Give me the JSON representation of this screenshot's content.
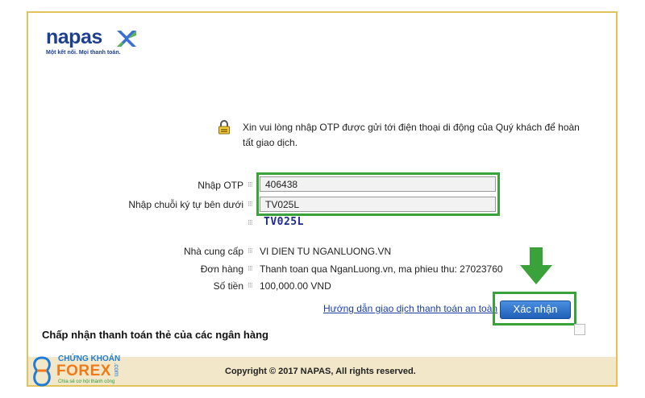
{
  "brand": {
    "name": "napas",
    "tagline": "Một kết nối. Mọi thanh toán.",
    "accent": "#1d3f8f"
  },
  "notice": "Xin vui lòng nhập OTP được gửi tới điện thoại di động của Quý khách để hoàn tất giao dịch.",
  "form": {
    "otp_label": "Nhập OTP",
    "otp_value": "406438",
    "captcha_label": "Nhập chuỗi ký tự bên dưới",
    "captcha_input_value": "TV025L",
    "captcha_text": "TV025L"
  },
  "details": {
    "provider_label": "Nhà cung cấp",
    "provider_value": "VI DIEN TU NGANLUONG.VN",
    "order_label": "Đơn hàng",
    "order_value": "Thanh toan qua NganLuong.vn, ma phieu thu: 27023760",
    "amount_label": "Số tiền",
    "amount_value": "100,000.00 VND"
  },
  "guide_link": "Hướng dẫn giao dịch thanh toán an toàn",
  "confirm_button": "Xác nhận",
  "banks_title": "Chấp nhận thanh toán thẻ của các ngân hàng",
  "copyright": "Copyright © 2017 NAPAS, All rights reserved.",
  "watermark": {
    "line1": "CHỨNG KHOÁN",
    "line2": "FOREX",
    "line3": "Chìa sẻ cơ hội thành công",
    "suffix": ".com"
  },
  "colors": {
    "highlight": "#3aa23a",
    "button": "#2a6fca",
    "frame": "#e2c25a",
    "footer": "#f2e7c8"
  },
  "separator": "⁝⁝⁝"
}
